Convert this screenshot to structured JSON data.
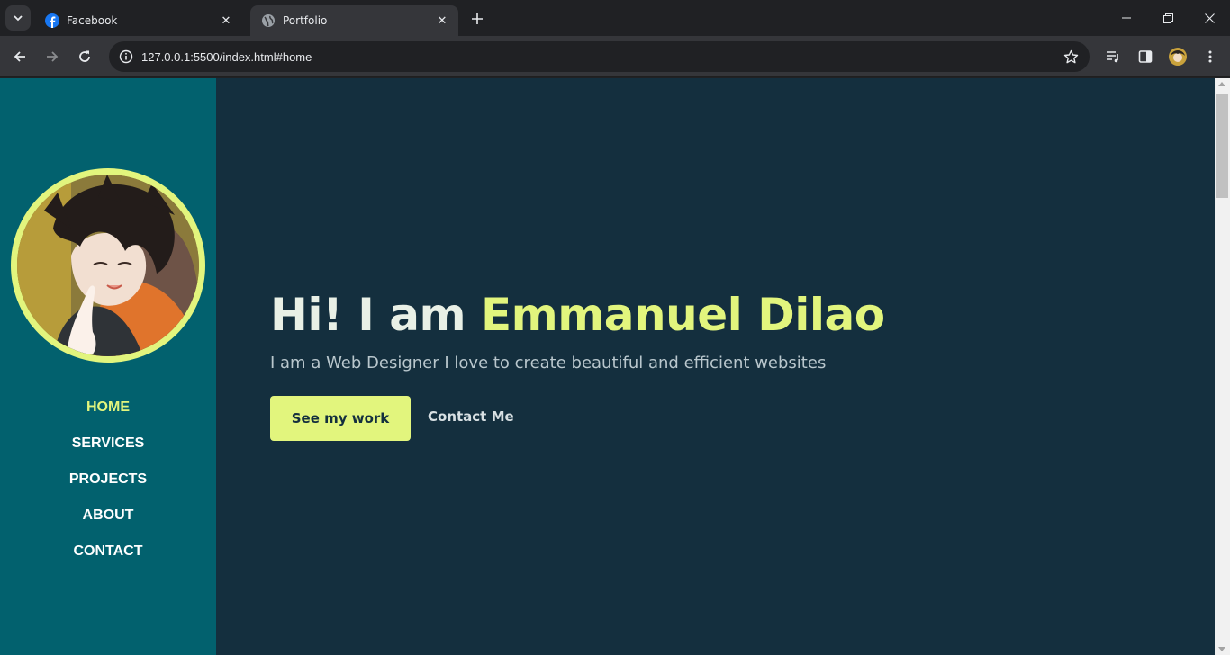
{
  "browser": {
    "tabs": [
      {
        "title": "Facebook",
        "icon": "facebook-icon",
        "active": false
      },
      {
        "title": "Portfolio",
        "icon": "globe-icon",
        "active": true
      }
    ],
    "url": "127.0.0.1:5500/index.html#home"
  },
  "sidebar": {
    "nav": [
      {
        "label": "HOME",
        "active": true
      },
      {
        "label": "SERVICES",
        "active": false
      },
      {
        "label": "PROJECTS",
        "active": false
      },
      {
        "label": "ABOUT",
        "active": false
      },
      {
        "label": "CONTACT",
        "active": false
      }
    ]
  },
  "hero": {
    "greeting": "Hi! I am ",
    "name": "Emmanuel Dilao",
    "subtitle": "I am a Web Designer I love to create beautiful and efficient websites",
    "primary_button": "See my work",
    "secondary_button": "Contact Me"
  },
  "colors": {
    "accent": "#e2f57d",
    "background": "#142f3e",
    "sidebar": "#02616e"
  }
}
